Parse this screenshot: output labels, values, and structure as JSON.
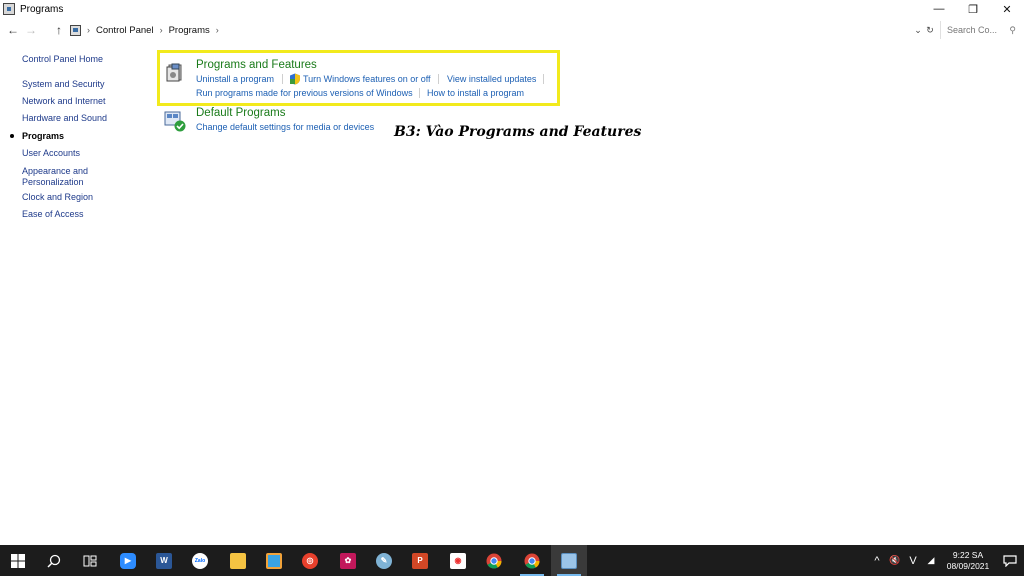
{
  "window": {
    "title": "Programs",
    "minimize": "—",
    "restore": "❐",
    "close": "✕"
  },
  "address": {
    "back": "←",
    "forward": "→",
    "up": "↑",
    "breadcrumb": [
      "Control Panel",
      "Programs"
    ],
    "separator": "›",
    "dropdown": "⌄",
    "refresh": "↻",
    "search_placeholder": "Search Co...",
    "search_icon": "⚲"
  },
  "sidebar": {
    "items": [
      {
        "label": "Control Panel Home"
      },
      {
        "label": "System and Security"
      },
      {
        "label": "Network and Internet"
      },
      {
        "label": "Hardware and Sound"
      },
      {
        "label": "Programs"
      },
      {
        "label": "User Accounts"
      },
      {
        "label": "Appearance and"
      },
      {
        "label": "Personalization"
      },
      {
        "label": "Clock and Region"
      },
      {
        "label": "Ease of Access"
      }
    ]
  },
  "categories": {
    "programs_features": {
      "title": "Programs and Features",
      "links": {
        "uninstall": "Uninstall a program",
        "windows_features": "Turn Windows features on or off",
        "installed_updates": "View installed updates",
        "compat": "Run programs made for previous versions of Windows",
        "how_install": "How to install a program"
      }
    },
    "default_programs": {
      "title": "Default Programs",
      "links": {
        "change_defaults": "Change default settings for media or devices"
      }
    }
  },
  "annotation": "B3: Vào Programs and Features",
  "taskbar": {
    "apps": [
      "start",
      "search",
      "task-view",
      "zoom",
      "word",
      "zalo",
      "file-explorer",
      "app-store",
      "photo",
      "flower",
      "paint",
      "powerpoint",
      "app",
      "chrome",
      "chrome-profile",
      "control-panel"
    ],
    "tray": {
      "chevron": "^",
      "volume": "🔇",
      "ime": "V",
      "wifi": "◢",
      "time": "9:22 SA",
      "date": "08/09/2021"
    }
  },
  "colors": {
    "highlight": "#f2ea1c",
    "category_title": "#1a7b1a",
    "link": "#1c5fb3",
    "taskbar": "#1c1c1c"
  }
}
